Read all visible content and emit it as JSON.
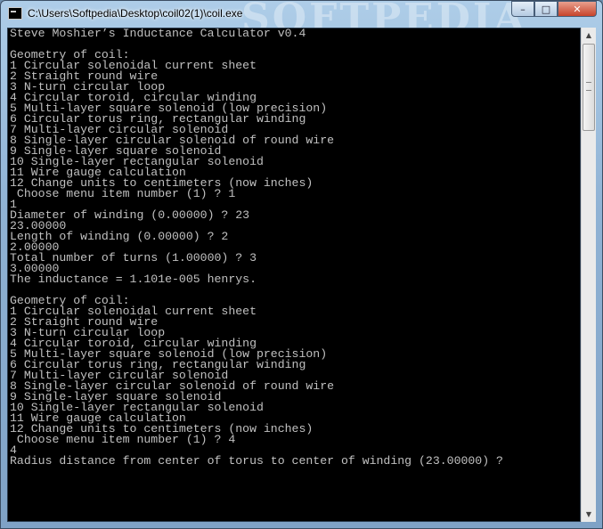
{
  "window": {
    "title": "C:\\Users\\Softpedia\\Desktop\\coil02(1)\\coil.exe",
    "watermark": "SOFTPEDIA",
    "controls": {
      "minimize": "–",
      "maximize": "□",
      "close": "✕"
    }
  },
  "console": {
    "lines": [
      "Steve Moshier’s Inductance Calculator v0.4",
      "",
      "Geometry of coil:",
      "1 Circular solenoidal current sheet",
      "2 Straight round wire",
      "3 N-turn circular loop",
      "4 Circular toroid, circular winding",
      "5 Multi-layer square solenoid (low precision)",
      "6 Circular torus ring, rectangular winding",
      "7 Multi-layer circular solenoid",
      "8 Single-layer circular solenoid of round wire",
      "9 Single-layer square solenoid",
      "10 Single-layer rectangular solenoid",
      "11 Wire gauge calculation",
      "12 Change units to centimeters (now inches)",
      " Choose menu item number (1) ? 1",
      "1",
      "Diameter of winding (0.00000) ? 23",
      "23.00000",
      "Length of winding (0.00000) ? 2",
      "2.00000",
      "Total number of turns (1.00000) ? 3",
      "3.00000",
      "The inductance = 1.101e-005 henrys.",
      "",
      "Geometry of coil:",
      "1 Circular solenoidal current sheet",
      "2 Straight round wire",
      "3 N-turn circular loop",
      "4 Circular toroid, circular winding",
      "5 Multi-layer square solenoid (low precision)",
      "6 Circular torus ring, rectangular winding",
      "7 Multi-layer circular solenoid",
      "8 Single-layer circular solenoid of round wire",
      "9 Single-layer square solenoid",
      "10 Single-layer rectangular solenoid",
      "11 Wire gauge calculation",
      "12 Change units to centimeters (now inches)",
      " Choose menu item number (1) ? 4",
      "4",
      "Radius distance from center of torus to center of winding (23.00000) ?"
    ]
  },
  "scrollbar": {
    "up": "▲",
    "down": "▼"
  }
}
